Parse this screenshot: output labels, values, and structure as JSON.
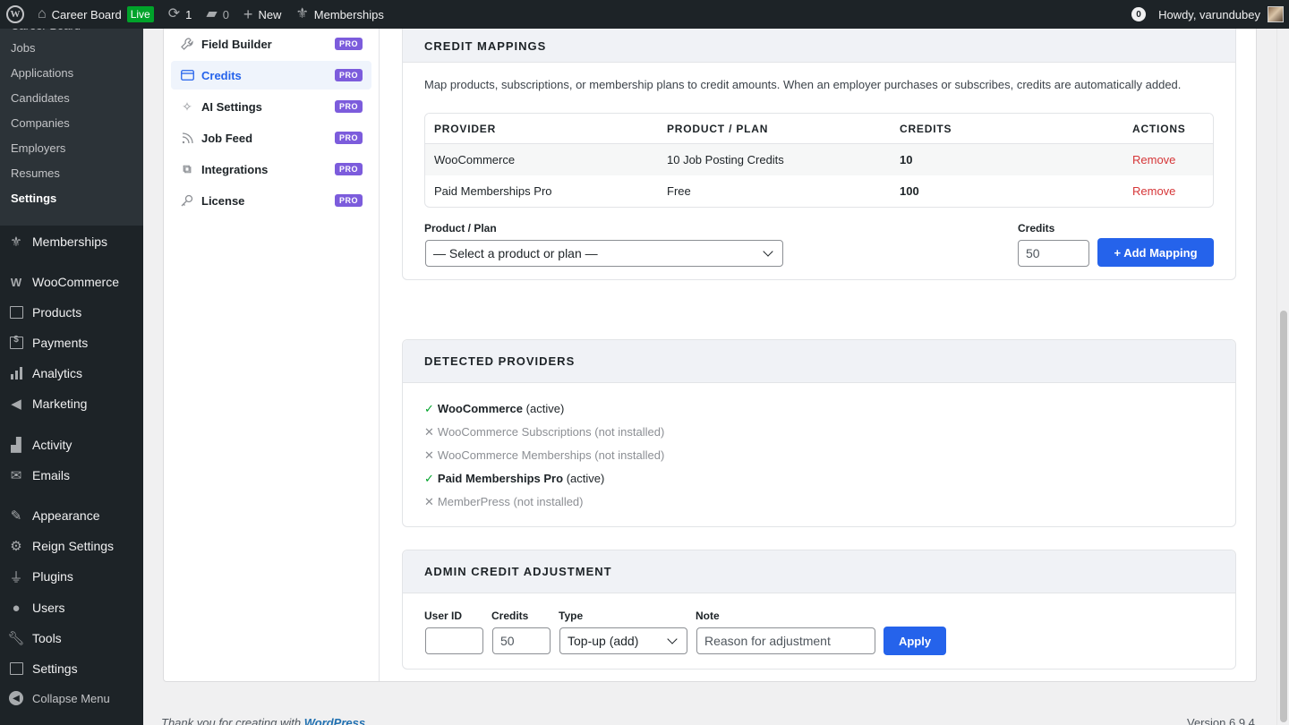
{
  "adminbar": {
    "site_name": "Career Board",
    "live_label": "Live",
    "updates_count": "1",
    "comments_count": "0",
    "new_label": "New",
    "memberships_label": "Memberships",
    "notifications_count": "0",
    "howdy": "Howdy, varundubey"
  },
  "sidebar": {
    "submenu": [
      "Career Board",
      "Jobs",
      "Applications",
      "Candidates",
      "Companies",
      "Employers",
      "Resumes",
      "Settings"
    ],
    "current_submenu": "Settings",
    "menu": {
      "memberships": "Memberships",
      "woocommerce": "WooCommerce",
      "products": "Products",
      "payments": "Payments",
      "analytics": "Analytics",
      "marketing": "Marketing",
      "activity": "Activity",
      "emails": "Emails",
      "appearance": "Appearance",
      "reign_settings": "Reign Settings",
      "plugins": "Plugins",
      "users": "Users",
      "tools": "Tools",
      "settings": "Settings",
      "collapse": "Collapse Menu"
    }
  },
  "settings_nav": {
    "items": [
      {
        "label": "Field Builder",
        "badge": "PRO"
      },
      {
        "label": "Credits",
        "badge": "PRO"
      },
      {
        "label": "AI Settings",
        "badge": "PRO"
      },
      {
        "label": "Job Feed",
        "badge": "PRO"
      },
      {
        "label": "Integrations",
        "badge": "PRO"
      },
      {
        "label": "License",
        "badge": "PRO"
      }
    ],
    "active": "Credits"
  },
  "credit_mappings": {
    "title": "CREDIT MAPPINGS",
    "description": "Map products, subscriptions, or membership plans to credit amounts. When an employer purchases or subscribes, credits are automatically added.",
    "columns": [
      "PROVIDER",
      "PRODUCT / PLAN",
      "CREDITS",
      "ACTIONS"
    ],
    "rows": [
      {
        "provider": "WooCommerce",
        "plan": "10 Job Posting Credits",
        "credits": "10",
        "action": "Remove"
      },
      {
        "provider": "Paid Memberships Pro",
        "plan": "Free",
        "credits": "100",
        "action": "Remove"
      }
    ],
    "product_label": "Product / Plan",
    "product_select": "— Select a product or plan —",
    "credits_label": "Credits",
    "credits_value": "50",
    "add_button": "+ Add Mapping"
  },
  "detected_providers": {
    "title": "DETECTED PROVIDERS",
    "items": [
      {
        "name": "WooCommerce",
        "status": "(active)",
        "active": true
      },
      {
        "name": "WooCommerce Subscriptions",
        "status": "(not installed)",
        "active": false
      },
      {
        "name": "WooCommerce Memberships",
        "status": "(not installed)",
        "active": false
      },
      {
        "name": "Paid Memberships Pro",
        "status": "(active)",
        "active": true
      },
      {
        "name": "MemberPress",
        "status": "(not installed)",
        "active": false
      }
    ],
    "check_mark": "✓",
    "cross_mark": "✕"
  },
  "admin_adjustment": {
    "title": "ADMIN CREDIT ADJUSTMENT",
    "user_id_label": "User ID",
    "user_id_value": "",
    "credits_label": "Credits",
    "credits_value": "50",
    "type_label": "Type",
    "type_value": "Top-up (add)",
    "note_label": "Note",
    "note_placeholder": "Reason for adjustment",
    "apply_button": "Apply"
  },
  "footer": {
    "thanks_prefix": "Thank you for creating with ",
    "wordpress_link": "WordPress",
    "version": "Version 6.9.4"
  },
  "colors": {
    "primary": "#2563eb",
    "pro_badge": "#7c5cdc",
    "remove": "#d63638",
    "active_check": "#00a32a",
    "sidebar_bg": "#1d2327"
  }
}
